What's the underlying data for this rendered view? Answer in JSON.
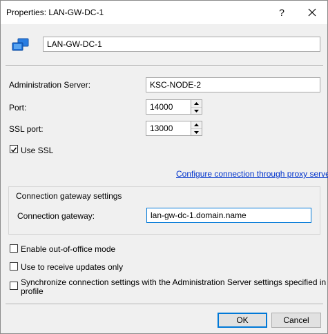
{
  "window": {
    "title": "Properties: LAN-GW-DC-1",
    "help_glyph": "?",
    "close_glyph": "✕"
  },
  "header": {
    "name_value": "LAN-GW-DC-1",
    "icon": "computers-icon"
  },
  "fields": {
    "admin_server_label": "Administration Server:",
    "admin_server_value": "KSC-NODE-2",
    "port_label": "Port:",
    "port_value": "14000",
    "ssl_port_label": "SSL port:",
    "ssl_port_value": "13000",
    "use_ssl_label": "Use SSL",
    "use_ssl_checked": true,
    "proxy_link": "Configure connection through proxy server"
  },
  "gateway": {
    "group_label": "Connection gateway settings",
    "gateway_label": "Connection gateway:",
    "gateway_value": "lan-gw-dc-1.domain.name"
  },
  "options": {
    "out_of_office_label": "Enable out-of-office mode",
    "updates_only_label": "Use to receive updates only",
    "sync_label_line1": "Synchronize connection settings with the Administration Server settings specified in this",
    "sync_label_line2": "profile"
  },
  "buttons": {
    "ok_label": "OK",
    "cancel_label": "Cancel"
  },
  "colors": {
    "link": "#0033cc",
    "focus_border": "#0078d7",
    "icon_blue": "#1e6fd9"
  }
}
